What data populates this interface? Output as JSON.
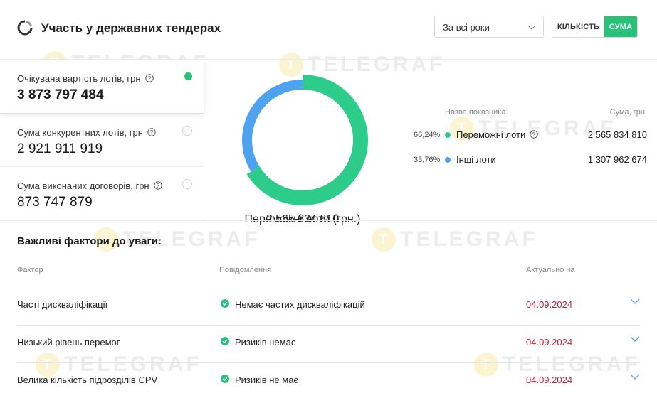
{
  "header": {
    "title": "Участь у державних тендерах",
    "period": "За всі роки",
    "toggle_count": "КІЛЬКІСТЬ",
    "toggle_sum": "СУМА"
  },
  "metrics": [
    {
      "label": "Очікувана вартість лотів, грн",
      "value": "3 873 797 484",
      "selected": true
    },
    {
      "label": "Сума конкурентних лотів, грн",
      "value": "2 921 911 919",
      "selected": false
    },
    {
      "label": "Сума виконаних договорів, грн",
      "value": "873 747 879",
      "selected": false
    }
  ],
  "chart_data": {
    "type": "pie",
    "center_label": "Переможні лоти (грн.)",
    "center_value": "2 565 834 810",
    "legend_header_name": "Назва показника",
    "legend_header_sum": "Сума, грн.",
    "slices": [
      {
        "name": "Переможні лоти",
        "percent": 66.24,
        "percent_label": "66,24%",
        "amount": "2 565 834 810",
        "value": 2565834810,
        "color": "#2ecc8b"
      },
      {
        "name": "Інші лоти",
        "percent": 33.76,
        "percent_label": "33,76%",
        "amount": "1 307 962 674",
        "value": 1307962674,
        "color": "#4da3f0"
      }
    ]
  },
  "factors": {
    "title": "Важливі фактори до уваги:",
    "col_factor": "Фактор",
    "col_message": "Повідомлення",
    "col_date": "Актуально на",
    "rows": [
      {
        "factor": "Часті дискваліфікації",
        "message": "Немає частих дискваліфікацій",
        "date": "04.09.2024"
      },
      {
        "factor": "Низький рівень перемог",
        "message": "Ризиків немає",
        "date": "04.09.2024"
      },
      {
        "factor": "Велика кількість підрозділів CPV",
        "message": "Ризиків не має",
        "date": "04.09.2024"
      }
    ]
  },
  "colors": {
    "accent": "#27c17a",
    "date": "#c0233b",
    "secondary": "#4da3f0"
  },
  "watermark": "TELEGRAF"
}
